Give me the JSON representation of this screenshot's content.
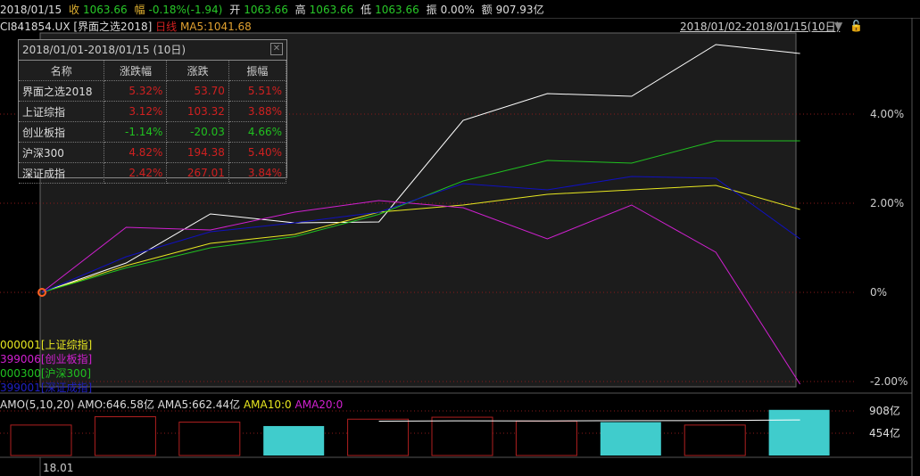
{
  "topbar": {
    "date": "2018/01/15",
    "close_label": "收",
    "close": "1063.66",
    "chg_label": "幅",
    "chg": "-0.18%(-1.94)",
    "open_label": "开",
    "open": "1063.66",
    "high_label": "高",
    "high": "1063.66",
    "low_label": "低",
    "low": "1063.66",
    "amp_label": "振",
    "amp": "0.00%",
    "amount_label": "额",
    "amount": "907.93亿"
  },
  "title": {
    "code": "CI841854.UX",
    "name": "[界面之选2018]",
    "period": "日线",
    "ma": "MA5:1041.68"
  },
  "range": "2018/01/02-2018/01/15(10日)",
  "popup": {
    "title": "2018/01/01-2018/01/15 (10日)",
    "headers": [
      "名称",
      "涨跌幅",
      "涨跌",
      "振幅"
    ],
    "rows": [
      [
        "界面之选2018",
        "5.32%",
        "53.70",
        "5.51%"
      ],
      [
        "上证综指",
        "3.12%",
        "103.32",
        "3.88%"
      ],
      [
        "创业板指",
        "-1.14%",
        "-20.03",
        "4.66%"
      ],
      [
        "沪深300",
        "4.82%",
        "194.38",
        "5.40%"
      ],
      [
        "深证成指",
        "2.42%",
        "267.01",
        "3.84%"
      ]
    ],
    "row_colors": [
      "up",
      "up",
      "down",
      "up",
      "up"
    ]
  },
  "legend": [
    {
      "code": "000001",
      "name": "[上证综指]",
      "color": "#e8e820"
    },
    {
      "code": "399006",
      "name": "[创业板指]",
      "color": "#d020d0"
    },
    {
      "code": "000300",
      "name": "[沪深300]",
      "color": "#20c020"
    },
    {
      "code": "399001",
      "name": "[深证成指]",
      "color": "#2020c0"
    }
  ],
  "amo": {
    "label": "AMO(5,10,20)",
    "amo": "AMO:646.58亿",
    "ama5": "AMA5:662.44亿",
    "ama10": "AMA10:0",
    "ama20": "AMA20:0"
  },
  "xaxis_label": "18.01",
  "chart_data": [
    {
      "type": "line",
      "ylabel": "%",
      "ylim": [
        -2.06,
        5.8
      ],
      "yticks": [
        "4.00%",
        "2.00%",
        "0%",
        "-2.00%"
      ],
      "ytick_values": [
        4,
        2,
        0,
        -2
      ],
      "series": [
        {
          "name": "界面之选2018",
          "color": "#ffffff",
          "values": [
            0,
            0.66,
            1.76,
            1.56,
            1.58,
            3.86,
            4.46,
            4.4,
            5.56,
            5.36
          ]
        },
        {
          "name": "上证综指",
          "color": "#e8e820",
          "values": [
            0,
            0.6,
            1.1,
            1.3,
            1.8,
            1.96,
            2.2,
            2.3,
            2.4,
            1.86
          ]
        },
        {
          "name": "创业板指",
          "color": "#d020d0",
          "values": [
            0,
            1.46,
            1.4,
            1.8,
            2.06,
            1.9,
            1.2,
            1.96,
            0.9,
            -2.06
          ]
        },
        {
          "name": "沪深300",
          "color": "#20c020",
          "values": [
            0,
            0.55,
            1.0,
            1.25,
            1.75,
            2.5,
            2.96,
            2.9,
            3.4,
            3.4
          ]
        },
        {
          "name": "深证成指",
          "color": "#1010c0",
          "values": [
            0,
            0.8,
            1.36,
            1.56,
            1.8,
            2.44,
            2.3,
            2.6,
            2.56,
            1.2
          ]
        }
      ]
    },
    {
      "type": "bar",
      "title": "AMO",
      "yticks": [
        "908亿",
        "454亿"
      ],
      "ytick_values": [
        908,
        454
      ],
      "values": [
        620,
        790,
        680,
        600,
        740,
        780,
        700,
        680,
        620,
        930
      ],
      "up": [
        false,
        false,
        false,
        true,
        false,
        false,
        false,
        true,
        false,
        true
      ],
      "ama5": [
        null,
        null,
        null,
        null,
        700,
        706,
        704,
        710,
        712,
        724
      ]
    }
  ]
}
